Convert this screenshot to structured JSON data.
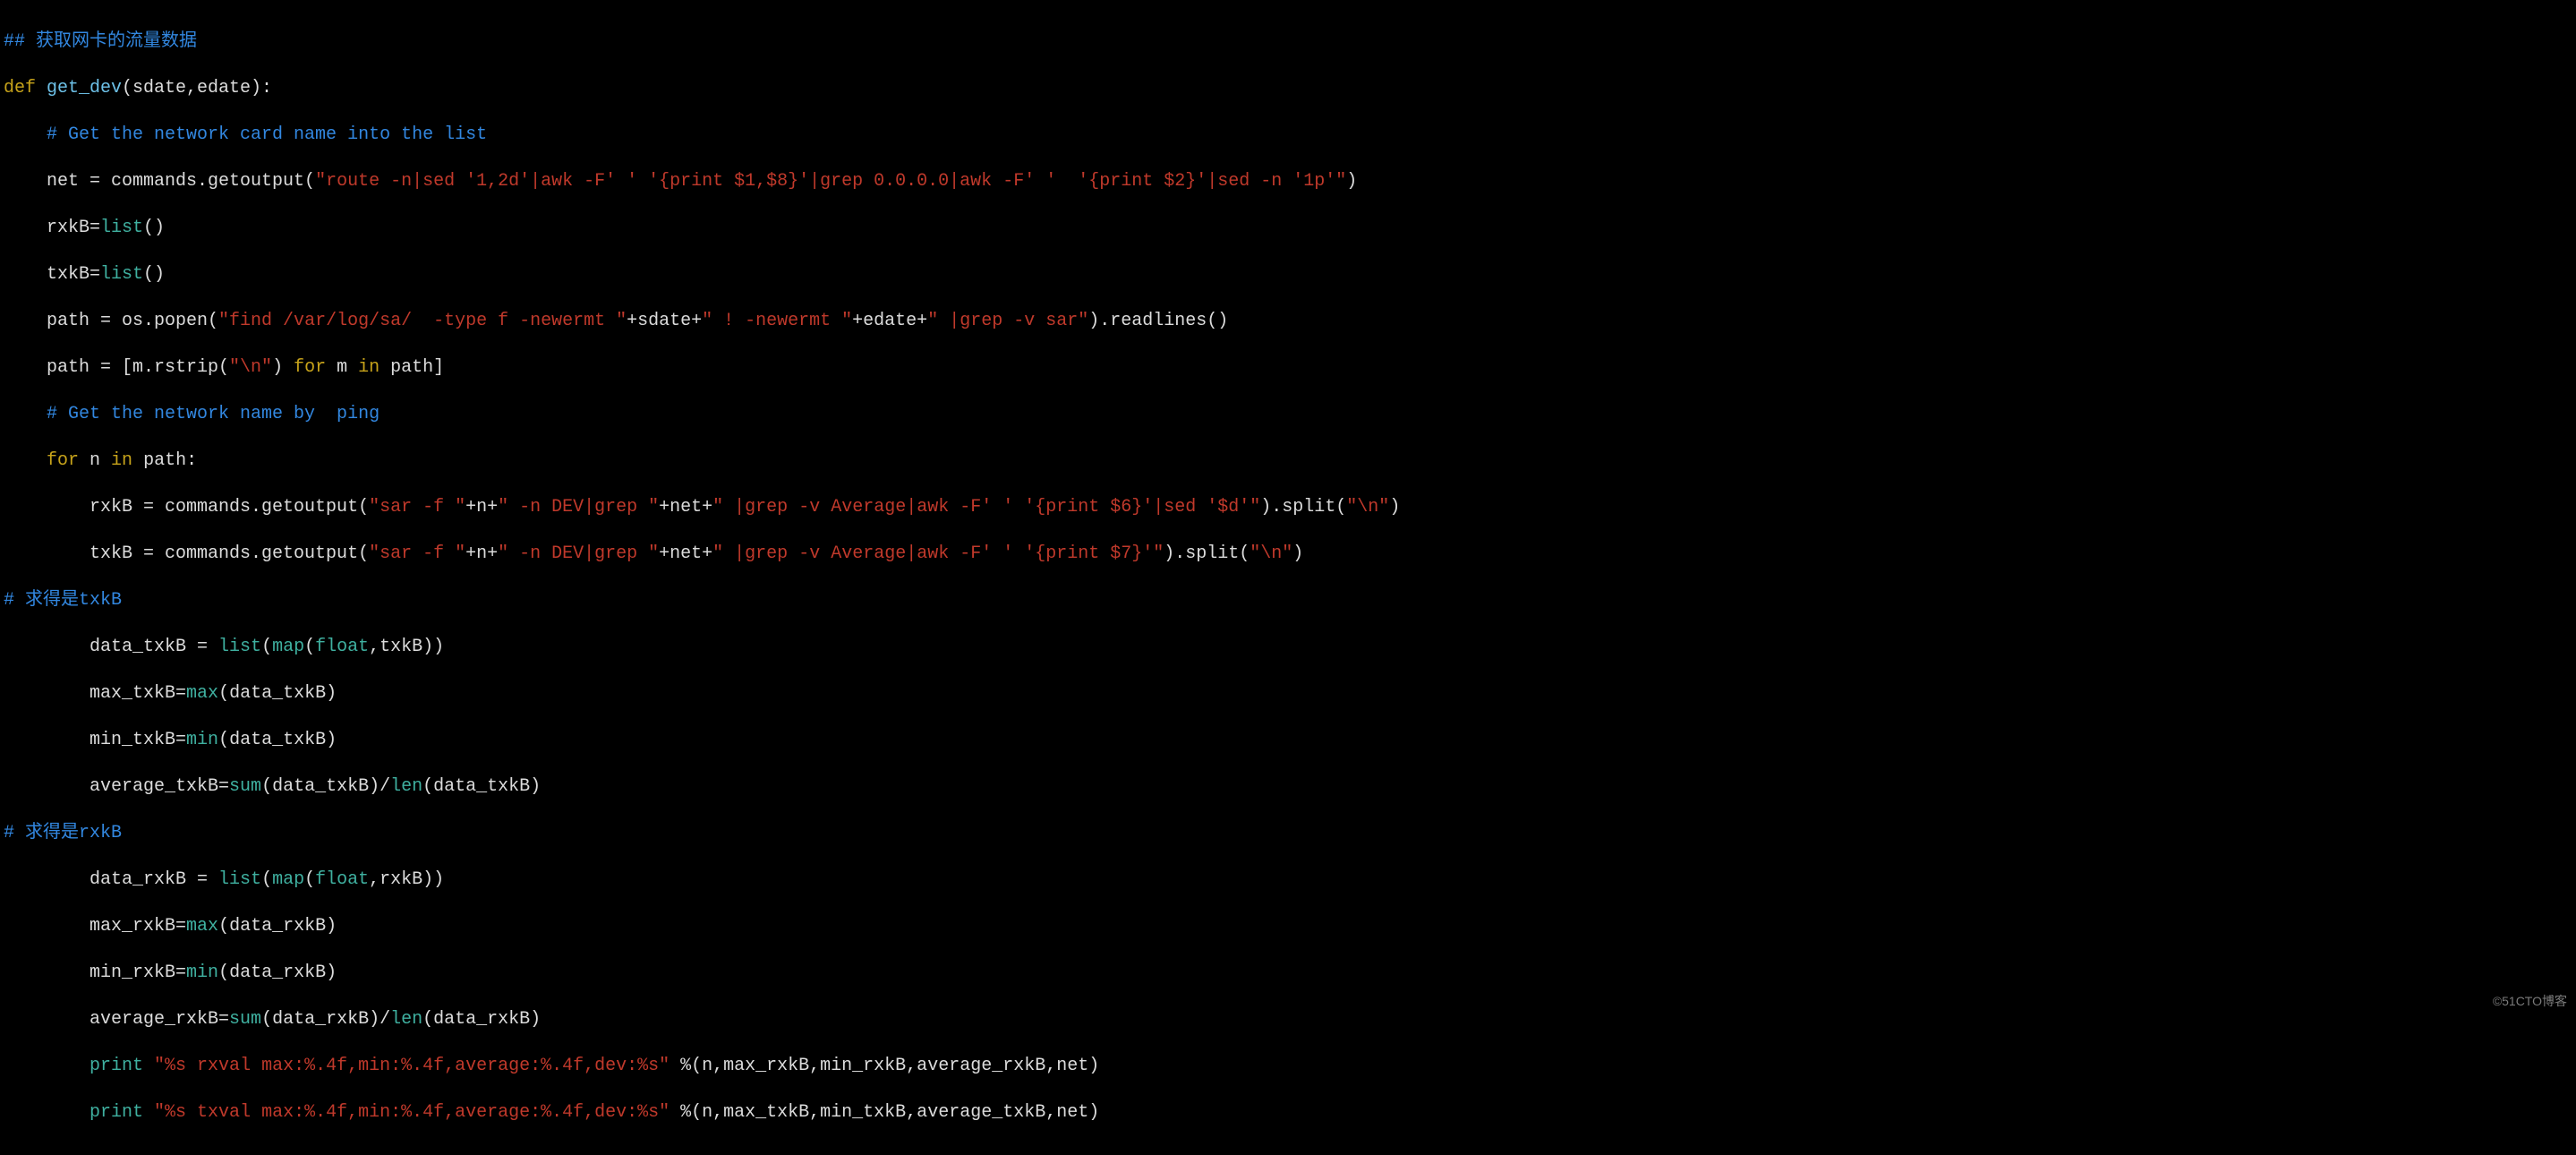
{
  "watermark": "©51CTO博客",
  "code": {
    "l1": {
      "a": "## 获取网卡的流量数据"
    },
    "l2": {
      "a": "def",
      "b": " get_dev",
      "c": "(sdate,edate):"
    },
    "l3": {
      "a": "    # Get the network card name into the list"
    },
    "l4": {
      "a": "    net = commands.getoutput(",
      "b": "\"route -n|sed '1,2d'|awk -F' ' '{print $1,$8}'|grep 0.0.0.0|awk -F' '  '{print $2}'|sed -n '1p'\"",
      "c": ")"
    },
    "l5": {
      "a": "    rxkB=",
      "b": "list",
      "c": "()"
    },
    "l6": {
      "a": "    txkB=",
      "b": "list",
      "c": "()"
    },
    "l7": {
      "a": "    path = os.popen(",
      "b": "\"find /var/log/sa/  -type f -newermt \"",
      "c": "+sdate+",
      "d": "\" ! -newermt \"",
      "e": "+edate+",
      "f": "\" |grep -v sar\"",
      "g": ").readlines()"
    },
    "l8": {
      "a": "    path = [m.rstrip(",
      "b": "\"\\n\"",
      "c": ") ",
      "d": "for",
      "e": " m ",
      "f": "in",
      "g": " path]"
    },
    "l9": {
      "a": "    # Get the network name by  ping"
    },
    "l10": {
      "a": "    ",
      "b": "for",
      "c": " n ",
      "d": "in",
      "e": " path:"
    },
    "l11": {
      "a": "        rxkB = commands.getoutput(",
      "b": "\"sar -f \"",
      "c": "+n+",
      "d": "\" -n DEV|grep \"",
      "e": "+net+",
      "f": "\" |grep -v Average|awk -F' ' '{print $6}'|sed '$d'\"",
      "g": ").split(",
      "h": "\"\\n\"",
      "i": ")"
    },
    "l12": {
      "a": "        txkB = commands.getoutput(",
      "b": "\"sar -f \"",
      "c": "+n+",
      "d": "\" -n DEV|grep \"",
      "e": "+net+",
      "f": "\" |grep -v Average|awk -F' ' '{print $7}'\"",
      "g": ").split(",
      "h": "\"\\n\"",
      "i": ")"
    },
    "l13": {
      "a": "# 求得是txkB"
    },
    "l14": {
      "a": "        data_txkB = ",
      "b": "list",
      "c": "(",
      "d": "map",
      "e": "(",
      "f": "float",
      "g": ",txkB))"
    },
    "l15": {
      "a": "        max_txkB=",
      "b": "max",
      "c": "(data_txkB)"
    },
    "l16": {
      "a": "        min_txkB=",
      "b": "min",
      "c": "(data_txkB)"
    },
    "l17": {
      "a": "        average_txkB=",
      "b": "sum",
      "c": "(data_txkB)/",
      "d": "len",
      "e": "(data_txkB)"
    },
    "l18": {
      "a": "# 求得是rxkB"
    },
    "l19": {
      "a": "        data_rxkB = ",
      "b": "list",
      "c": "(",
      "d": "map",
      "e": "(",
      "f": "float",
      "g": ",rxkB))"
    },
    "l20": {
      "a": "        max_rxkB=",
      "b": "max",
      "c": "(data_rxkB)"
    },
    "l21": {
      "a": "        min_rxkB=",
      "b": "min",
      "c": "(data_rxkB)"
    },
    "l22": {
      "a": "        average_rxkB=",
      "b": "sum",
      "c": "(data_rxkB)/",
      "d": "len",
      "e": "(data_rxkB)"
    },
    "l23": {
      "a": "        ",
      "b": "print",
      "c": " ",
      "d": "\"%s rxval max:%.4f,min:%.4f,average:%.4f,dev:%s\"",
      "e": " %(n,max_rxkB,min_rxkB,average_rxkB,net)"
    },
    "l24": {
      "a": "        ",
      "b": "print",
      "c": " ",
      "d": "\"%s txval max:%.4f,min:%.4f,average:%.4f,dev:%s\"",
      "e": " %(n,max_txkB,min_txkB,average_txkB,net)"
    }
  }
}
